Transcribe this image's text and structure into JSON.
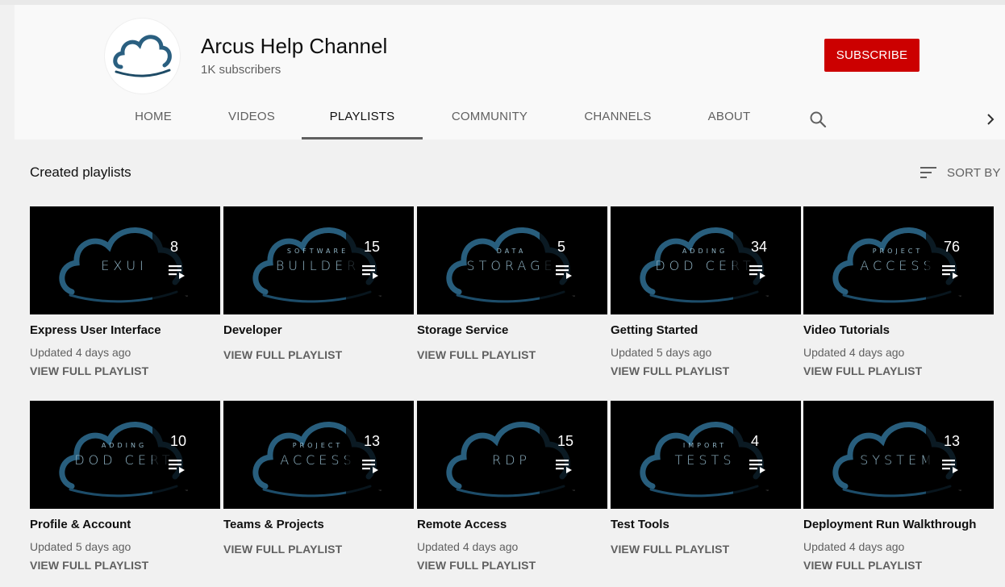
{
  "channel": {
    "name": "Arcus Help Channel",
    "subscribers": "1K subscribers",
    "subscribe_label": "SUBSCRIBE"
  },
  "tabs": [
    {
      "label": "HOME"
    },
    {
      "label": "VIDEOS"
    },
    {
      "label": "PLAYLISTS",
      "active": true
    },
    {
      "label": "COMMUNITY"
    },
    {
      "label": "CHANNELS"
    },
    {
      "label": "ABOUT"
    }
  ],
  "section": {
    "title": "Created playlists",
    "sort_label": "SORT BY"
  },
  "playlists": [
    {
      "title": "Express User Interface",
      "count": "8",
      "thumb_small": "",
      "thumb_word": "EXUI",
      "updated": "Updated 4 days ago",
      "link": "VIEW FULL PLAYLIST"
    },
    {
      "title": "Developer",
      "count": "15",
      "thumb_small": "SOFTWARE",
      "thumb_word": "BUILDER",
      "updated": "",
      "link": "VIEW FULL PLAYLIST"
    },
    {
      "title": "Storage Service",
      "count": "5",
      "thumb_small": "DATA",
      "thumb_word": "STORAGE",
      "updated": "",
      "link": "VIEW FULL PLAYLIST"
    },
    {
      "title": "Getting Started",
      "count": "34",
      "thumb_small": "ADDING",
      "thumb_word": "DOD CERT",
      "updated": "Updated 5 days ago",
      "link": "VIEW FULL PLAYLIST"
    },
    {
      "title": "Video Tutorials",
      "count": "76",
      "thumb_small": "PROJECT",
      "thumb_word": "ACCESS",
      "updated": "Updated 4 days ago",
      "link": "VIEW FULL PLAYLIST"
    },
    {
      "title": "Profile & Account",
      "count": "10",
      "thumb_small": "ADDING",
      "thumb_word": "DOD CERT",
      "updated": "Updated 5 days ago",
      "link": "VIEW FULL PLAYLIST"
    },
    {
      "title": "Teams & Projects",
      "count": "13",
      "thumb_small": "PROJECT",
      "thumb_word": "ACCESS",
      "updated": "",
      "link": "VIEW FULL PLAYLIST"
    },
    {
      "title": "Remote Access",
      "count": "15",
      "thumb_small": "",
      "thumb_word": "RDP",
      "updated": "Updated 4 days ago",
      "link": "VIEW FULL PLAYLIST"
    },
    {
      "title": "Test Tools",
      "count": "4",
      "thumb_small": "IMPORT",
      "thumb_word": "TESTS",
      "updated": "",
      "link": "VIEW FULL PLAYLIST"
    },
    {
      "title": "Deployment Run Walkthrough",
      "count": "13",
      "thumb_small": "",
      "thumb_word": "SYSTEM",
      "updated": "Updated 4 days ago",
      "link": "VIEW FULL PLAYLIST"
    }
  ],
  "icons": {
    "search": "search-icon",
    "next": "chevron-right-icon",
    "sort": "sort-icon",
    "playlist": "playlist-icon"
  },
  "colors": {
    "subscribe": "#cc0000",
    "cloud": "#2f6f93"
  }
}
